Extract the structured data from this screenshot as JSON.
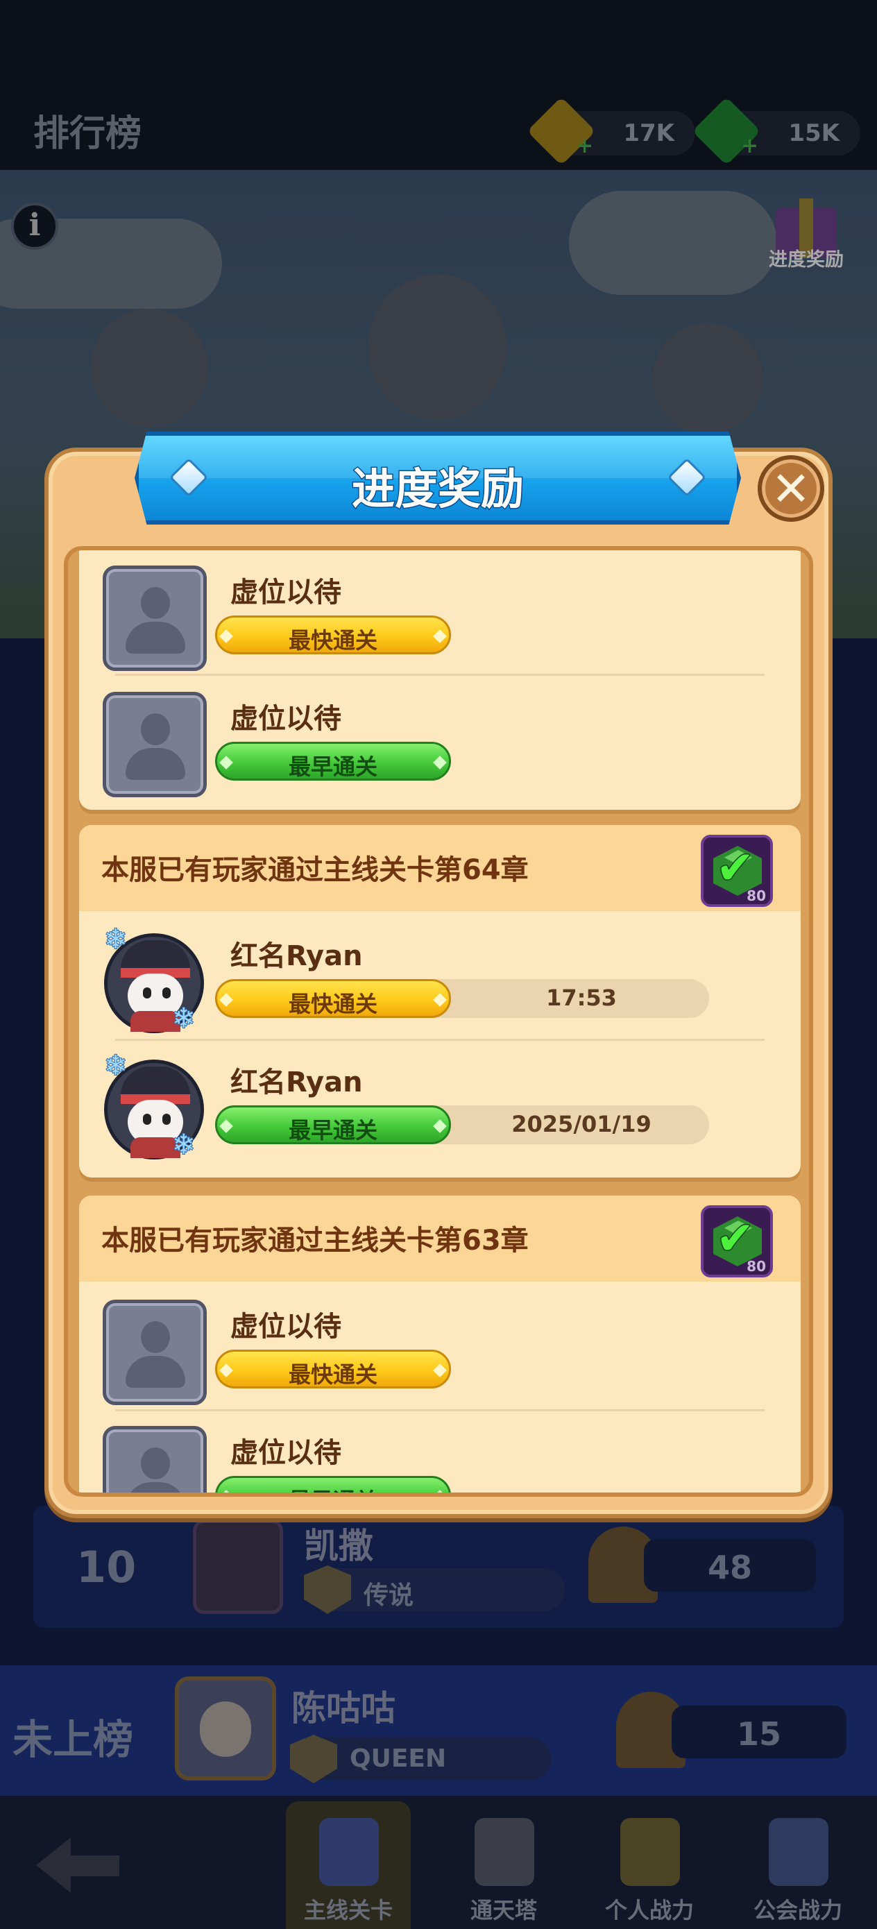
{
  "header": {
    "title": "排行榜",
    "gold": {
      "icon": "gold-coin-icon",
      "value": "17K"
    },
    "gems": {
      "icon": "green-gem-icon",
      "value": "15K"
    }
  },
  "scene": {
    "info_icon": "info-icon",
    "gift_label": "进度奖励"
  },
  "leaderboard_row": {
    "rank": "10",
    "name": "凯撒",
    "tier": "传说",
    "score": "48"
  },
  "my_row": {
    "rank": "未上榜",
    "name": "陈咕咕",
    "tier": "QUEEN",
    "score": "15"
  },
  "tabs": [
    {
      "label": "主线关卡",
      "active": true
    },
    {
      "label": "通天塔",
      "active": false
    },
    {
      "label": "个人战力",
      "active": false
    },
    {
      "label": "公会战力",
      "active": false
    }
  ],
  "modal": {
    "title": "进度奖励",
    "close_icon": "close-icon",
    "cards": [
      {
        "header": "",
        "entries": [
          {
            "name": "虚位以待",
            "badge": "最快通关",
            "badge_color": "#ffc91a",
            "value": ""
          },
          {
            "name": "虚位以待",
            "badge": "最早通关",
            "badge_color": "#44c939",
            "value": ""
          }
        ]
      },
      {
        "header": "本服已有玩家通过主线关卡第64章",
        "reward_count": "80",
        "entries": [
          {
            "name": "红名Ryan",
            "badge": "最快通关",
            "badge_color": "#ffc91a",
            "value": "17:53"
          },
          {
            "name": "红名Ryan",
            "badge": "最早通关",
            "badge_color": "#44c939",
            "value": "2025/01/19"
          }
        ]
      },
      {
        "header": "本服已有玩家通过主线关卡第63章",
        "reward_count": "80",
        "entries": [
          {
            "name": "虚位以待",
            "badge": "最快通关",
            "badge_color": "#ffc91a",
            "value": ""
          },
          {
            "name": "虚位以待",
            "badge": "最早通关",
            "badge_color": "#44c939",
            "value": ""
          }
        ]
      }
    ]
  }
}
